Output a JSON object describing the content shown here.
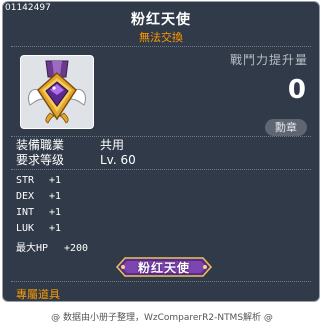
{
  "item": {
    "id": "01142497",
    "name": "粉红天使",
    "untradeable": "無法交換",
    "power_label": "戰鬥力提升量",
    "power_value": "0",
    "category_badge": "勳章",
    "requirements": [
      {
        "key": "装備職業",
        "value": "共用"
      },
      {
        "key": "要求等级",
        "value": "Lv. 60"
      }
    ],
    "stats": [
      {
        "key": "STR",
        "value": "+1"
      },
      {
        "key": "DEX",
        "value": "+1"
      },
      {
        "key": "INT",
        "value": "+1"
      },
      {
        "key": "LUK",
        "value": "+1"
      },
      {
        "key": "最大HP",
        "value": "+200"
      }
    ],
    "title_badge": "粉红天使",
    "exclusive_label": "專屬道具",
    "icon": "angel-medal-icon"
  },
  "footer": "@ 数据由小册子整理，WzComparerR2-NTMS解析 @",
  "colors": {
    "panel": "#303a48",
    "accent": "#ff9a00",
    "badge_purple": "#5b2a86"
  }
}
